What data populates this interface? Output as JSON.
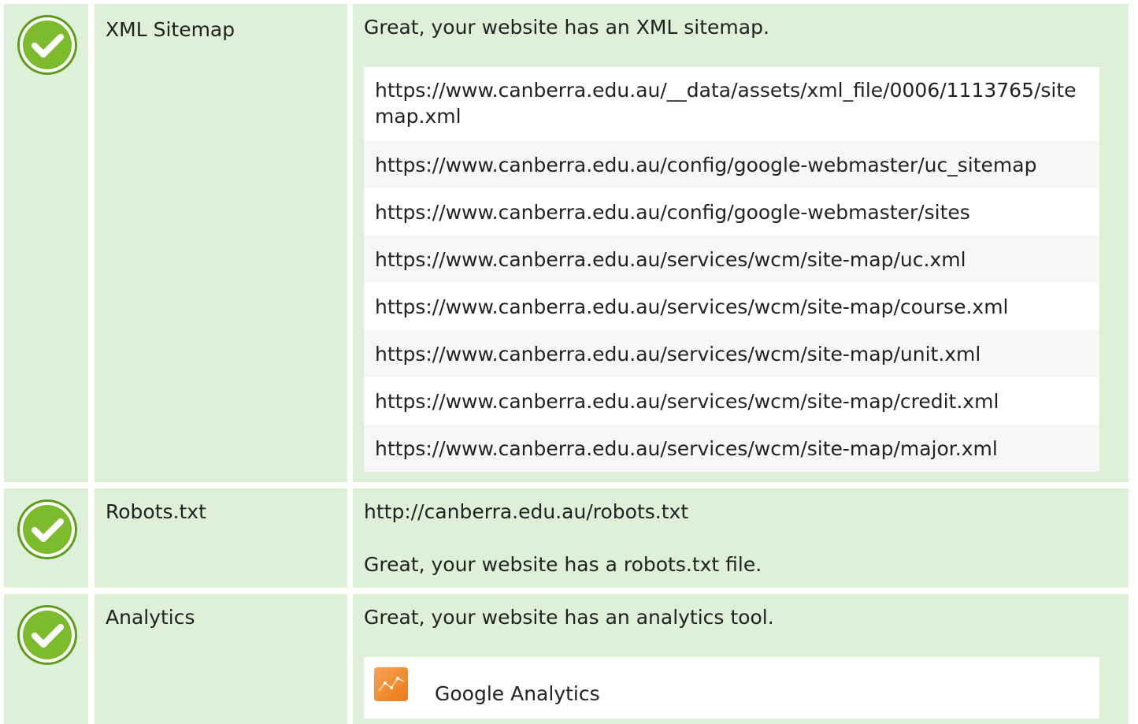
{
  "rows": {
    "sitemap": {
      "label": "XML Sitemap",
      "message": "Great, your website has an XML sitemap.",
      "urls": [
        "https://www.canberra.edu.au/__data/assets/xml_file/0006/1113765/sitemap.xml",
        "https://www.canberra.edu.au/config/google-webmaster/uc_sitemap",
        "https://www.canberra.edu.au/config/google-webmaster/sites",
        "https://www.canberra.edu.au/services/wcm/site-map/uc.xml",
        "https://www.canberra.edu.au/services/wcm/site-map/course.xml",
        "https://www.canberra.edu.au/services/wcm/site-map/unit.xml",
        "https://www.canberra.edu.au/services/wcm/site-map/credit.xml",
        "https://www.canberra.edu.au/services/wcm/site-map/major.xml"
      ]
    },
    "robots": {
      "label": "Robots.txt",
      "url": "http://canberra.edu.au/robots.txt",
      "message": "Great, your website has a robots.txt file."
    },
    "analytics": {
      "label": "Analytics",
      "message": "Great, your website has an analytics tool.",
      "tool_name": "Google Analytics"
    }
  },
  "colors": {
    "row_background": "#dff0d8",
    "check_green": "#7cbb2b",
    "analytics_logo": "#f08a2c"
  },
  "icons": {
    "status": "check-circle-icon",
    "analytics_tool": "google-analytics-logo-icon"
  }
}
